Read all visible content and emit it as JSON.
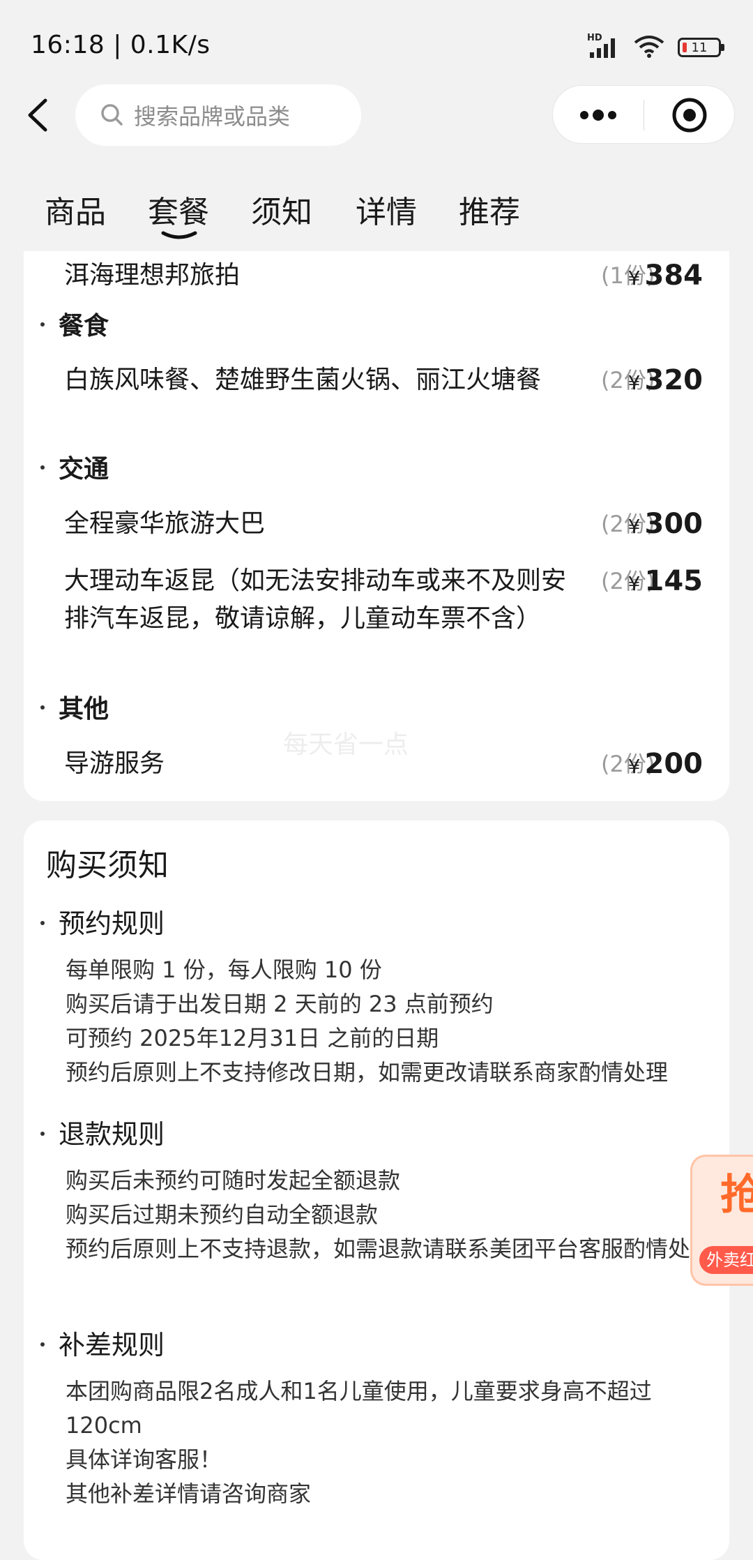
{
  "status_bar": {
    "time": "16:18 | 0.1K/s",
    "battery": "11",
    "network_label": "HD"
  },
  "header": {
    "search_placeholder": "搜索品牌或品类"
  },
  "tabs": [
    {
      "label": "商品"
    },
    {
      "label": "套餐",
      "active": true
    },
    {
      "label": "须知"
    },
    {
      "label": "详情"
    },
    {
      "label": "推荐"
    }
  ],
  "package": {
    "currency": "¥",
    "items": [
      {
        "name": "洱海理想邦旅拍",
        "qty": "(1份)",
        "price": "384"
      },
      {
        "category": "餐食"
      },
      {
        "name": "白族风味餐、楚雄野生菌火锅、丽江火塘餐",
        "qty": "(2份)",
        "price": "320"
      },
      {
        "category": "交通"
      },
      {
        "name": "全程豪华旅游大巴",
        "qty": "(2份)",
        "price": "300"
      },
      {
        "name": "大理动车返昆（如无法安排动车或来不及则安排汽车返昆，敬请谅解，儿童动车票不含）",
        "qty": "(2份)",
        "price": "145"
      },
      {
        "category": "其他"
      },
      {
        "name": "导游服务",
        "qty": "(2份)",
        "price": "200"
      }
    ],
    "watermark": "每天省一点"
  },
  "notice": {
    "title": "购买须知",
    "sections": [
      {
        "heading": "预约规则",
        "lines": [
          "每单限购 1 份，每人限购 10 份",
          "购买后请于出发日期 2 天前的 23 点前预约",
          "可预约 2025年12月31日 之前的日期",
          "预约后原则上不支持修改日期，如需更改请联系商家酌情处理"
        ]
      },
      {
        "heading": "退款规则",
        "lines": [
          "购买后未预约可随时发起全额退款",
          "购买后过期未预约自动全额退款",
          "预约后原则上不支持退款，如需退款请联系美团平台客服酌情处理"
        ]
      },
      {
        "heading": "补差规则",
        "lines": [
          "本团购商品限2名成人和1名儿童使用，儿童要求身高不超过120cm",
          "具体详询客服！",
          "其他补差详情请咨询商家"
        ]
      }
    ]
  },
  "float_badge": {
    "char": "抢",
    "label": "外卖红包"
  },
  "colors": {
    "background": "#f2f2f2",
    "card": "#ffffff",
    "text": "#1a1a1a",
    "muted": "#9a9a9a",
    "badge_accent": "#ff5a4a"
  }
}
